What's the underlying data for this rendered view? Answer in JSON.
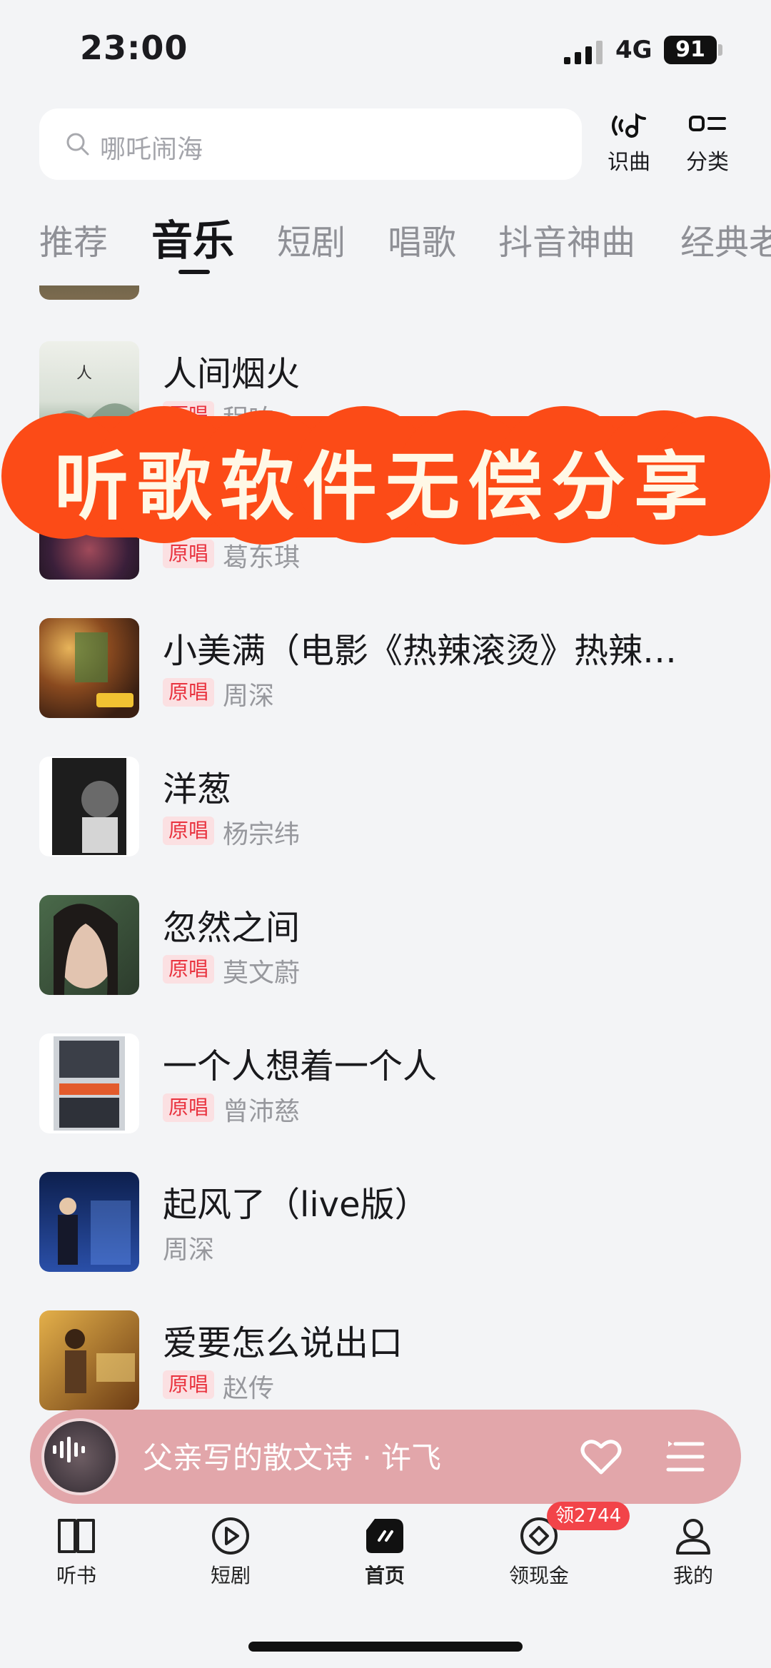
{
  "status_bar": {
    "time": "23:00",
    "network": "4G",
    "battery": "91"
  },
  "search": {
    "placeholder": "哪吒闹海"
  },
  "top_actions": [
    {
      "label": "识曲",
      "icon": "music-recognize-icon"
    },
    {
      "label": "分类",
      "icon": "category-icon"
    }
  ],
  "tabs": [
    "推荐",
    "音乐",
    "短剧",
    "唱歌",
    "抖音神曲",
    "经典老"
  ],
  "active_tab": "音乐",
  "songs": [
    {
      "title": "",
      "badge": "",
      "artist": ""
    },
    {
      "title": "人间烟火",
      "badge": "原唱",
      "artist": "程响"
    },
    {
      "title": "",
      "badge": "原唱",
      "artist": "葛东琪"
    },
    {
      "title": "小美满（电影《热辣滚烫》热辣…",
      "badge": "原唱",
      "artist": "周深"
    },
    {
      "title": "洋葱",
      "badge": "原唱",
      "artist": "杨宗纬"
    },
    {
      "title": "忽然之间",
      "badge": "原唱",
      "artist": "莫文蔚"
    },
    {
      "title": "一个人想着一个人",
      "badge": "原唱",
      "artist": "曾沛慈"
    },
    {
      "title": "起风了（live版）",
      "badge": "",
      "artist": "周深"
    },
    {
      "title": "爱要怎么说出口",
      "badge": "原唱",
      "artist": "赵传"
    }
  ],
  "overlay": {
    "text": "听歌软件无偿分享"
  },
  "mini_player": {
    "title": "父亲写的散文诗 · 许飞"
  },
  "bottom_nav": [
    {
      "label": "听书",
      "icon": "book-icon"
    },
    {
      "label": "短剧",
      "icon": "play-icon"
    },
    {
      "label": "首页",
      "icon": "home-icon"
    },
    {
      "label": "领现金",
      "icon": "coin-icon"
    },
    {
      "label": "我的",
      "icon": "profile-icon"
    }
  ],
  "cash_badge": "领2744",
  "colors": {
    "accent_red": "#e9333f",
    "banner_red": "#fc4b17",
    "player_pink": "#e2a6aa"
  }
}
